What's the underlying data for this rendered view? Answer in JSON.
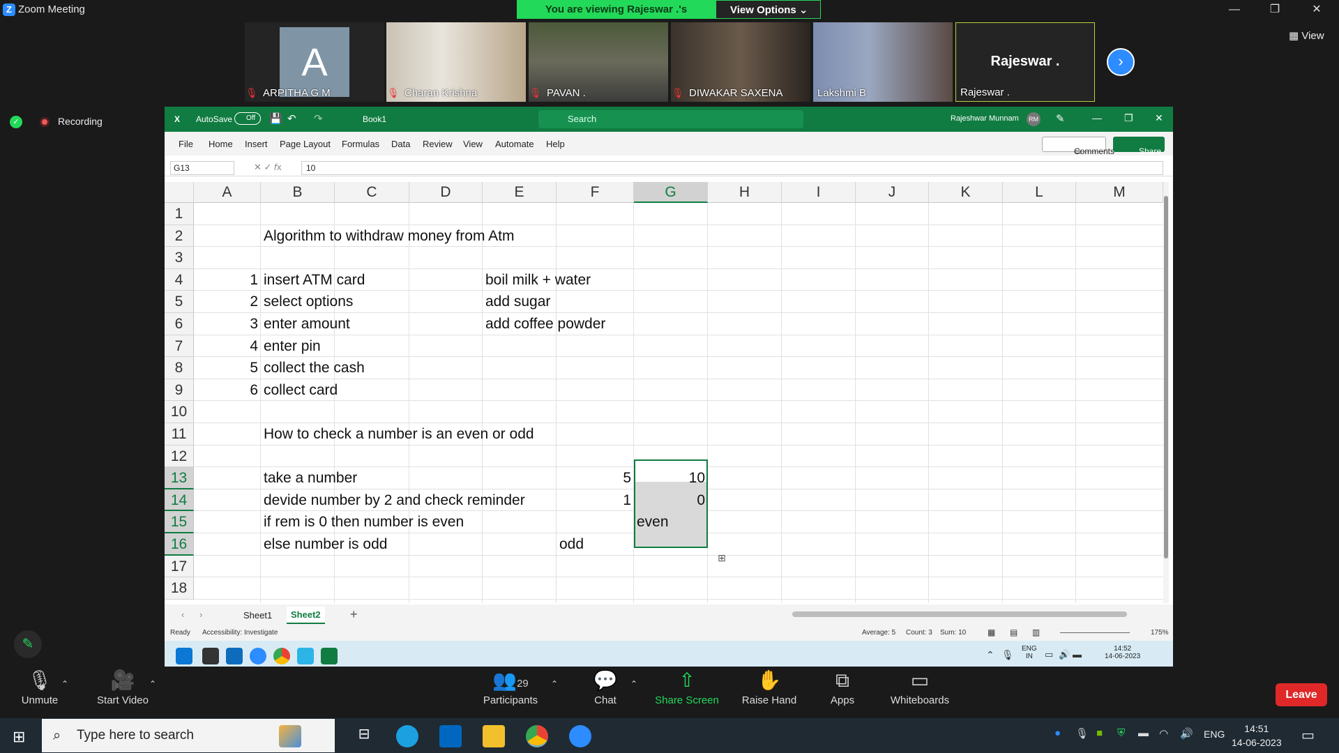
{
  "window": {
    "title": "Zoom Meeting",
    "banner": "You are viewing Rajeswar .'s screen",
    "view_options": "View Options",
    "view_button": "View"
  },
  "participants": [
    {
      "name": "ARPITHA G M",
      "initial": "A"
    },
    {
      "name": "Charan Krishna"
    },
    {
      "name": "PAVAN ."
    },
    {
      "name": "DIWAKAR SAXENA"
    },
    {
      "name": "Lakshmi B"
    },
    {
      "name": "Rajeswar .",
      "display": "Rajeswar ."
    }
  ],
  "recording": "Recording",
  "excel": {
    "autosave": "AutoSave",
    "autosave_state": "Off",
    "filename": "Book1",
    "search_placeholder": "Search",
    "user": "Rajeshwar Munnam",
    "user_initials": "RM",
    "ribbon": [
      "File",
      "Home",
      "Insert",
      "Page Layout",
      "Formulas",
      "Data",
      "Review",
      "View",
      "Automate",
      "Help"
    ],
    "comments": "Comments",
    "share": "Share",
    "namebox": "G13",
    "formula": "10",
    "columns": [
      "A",
      "B",
      "C",
      "D",
      "E",
      "F",
      "G",
      "H",
      "I",
      "J",
      "K",
      "L",
      "M"
    ],
    "rows": [
      "1",
      "2",
      "3",
      "4",
      "5",
      "6",
      "7",
      "8",
      "9",
      "10",
      "11",
      "12",
      "13",
      "14",
      "15",
      "16",
      "17",
      "18"
    ],
    "cells": {
      "B2": "Algorithm to withdraw money from Atm",
      "A4": "1",
      "B4": "insert ATM card",
      "E4": "boil milk + water",
      "A5": "2",
      "B5": "select options",
      "E5": "add sugar",
      "A6": "3",
      "B6": "enter amount",
      "E6": "add coffee powder",
      "A7": "4",
      "B7": "enter pin",
      "A8": "5",
      "B8": "collect the cash",
      "A9": "6",
      "B9": "collect card",
      "B11": "How to check a number is an even or odd",
      "B13": "take a number",
      "F13": "5",
      "G13": "10",
      "B14": "devide number by 2 and check reminder",
      "F14": "1",
      "G14": "0",
      "B15": "if rem is 0 then number is even",
      "G15": "even",
      "B16": "else number is odd",
      "F16": "odd"
    },
    "sheets": [
      "Sheet1",
      "Sheet2"
    ],
    "status": {
      "ready": "Ready",
      "accessibility": "Accessibility: Investigate",
      "average": "Average: 5",
      "count": "Count: 3",
      "sum": "Sum: 10",
      "zoom": "175%"
    },
    "inner_clock": {
      "lang": "ENG",
      "region": "IN",
      "time": "14:52",
      "date": "14-06-2023"
    }
  },
  "toolbar": {
    "unmute": "Unmute",
    "start_video": "Start Video",
    "participants_count": "29",
    "participants": "Participants",
    "chat": "Chat",
    "share_screen": "Share Screen",
    "raise_hand": "Raise Hand",
    "apps": "Apps",
    "whiteboards": "Whiteboards",
    "leave": "Leave"
  },
  "taskbar": {
    "search_placeholder": "Type here to search",
    "lang": "ENG",
    "time": "14:51",
    "date": "14-06-2023"
  }
}
